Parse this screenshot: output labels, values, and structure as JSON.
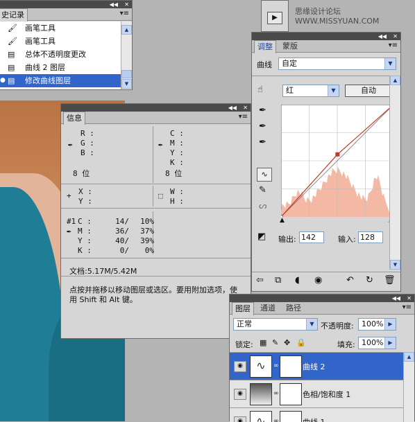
{
  "watermark": "思缘设计论坛 WWW.MISSYUAN.COM",
  "history": {
    "tab": "史记录",
    "items": [
      {
        "label": "画笔工具",
        "icon": "brush-icon"
      },
      {
        "label": "画笔工具",
        "icon": "brush-icon"
      },
      {
        "label": "总体不透明度更改",
        "icon": "document-icon"
      },
      {
        "label": "曲线 2 图层",
        "icon": "document-icon"
      },
      {
        "label": "修改曲线图层",
        "icon": "document-icon",
        "selected": true
      }
    ]
  },
  "info": {
    "tab": "信息",
    "rgb_labels": [
      "R :",
      "G :",
      "B :"
    ],
    "cmyk_labels": [
      "C :",
      "M :",
      "Y :",
      "K :"
    ],
    "bit_left": "8 位",
    "bit_right": "8 位",
    "xy": [
      "X :",
      "Y :"
    ],
    "wh": [
      "W :",
      "H :"
    ],
    "sample_id": "#1",
    "sample_rows": [
      {
        "label": "C :",
        "value": "14/",
        "pct": "10%"
      },
      {
        "label": "M :",
        "value": "36/",
        "pct": "37%"
      },
      {
        "label": "Y :",
        "value": "40/",
        "pct": "39%"
      },
      {
        "label": "K :",
        "value": "0/",
        "pct": "0%"
      }
    ],
    "doc": "文档:5.17M/5.42M",
    "hint": "点按并拖移以移动图层或选区。要用附加选项，使用 Shift 和 Alt 键。"
  },
  "adjust": {
    "tabs": [
      "调整",
      "蒙版"
    ],
    "curve_label": "曲线",
    "preset": "自定",
    "channel": "红",
    "auto_button": "自动",
    "output_label": "输出:",
    "output_value": "142",
    "input_label": "输入:",
    "input_value": "128",
    "curve_points": [
      [
        0,
        0
      ],
      [
        128,
        142
      ],
      [
        255,
        255
      ]
    ]
  },
  "layers": {
    "tabs": [
      "图层",
      "通道",
      "路径"
    ],
    "blend_mode": "正常",
    "opacity_label": "不透明度:",
    "opacity": "100%",
    "lock_label": "锁定:",
    "fill_label": "填充:",
    "fill": "100%",
    "rows": [
      {
        "name": "曲线 2",
        "selected": true
      },
      {
        "name": "色相/饱和度 1",
        "selected": false
      },
      {
        "name": "曲线 1",
        "selected": false
      }
    ]
  },
  "colors": {
    "selected": "#3165c9",
    "curve": "#c0392b",
    "histogram": "#f3b9a5"
  }
}
